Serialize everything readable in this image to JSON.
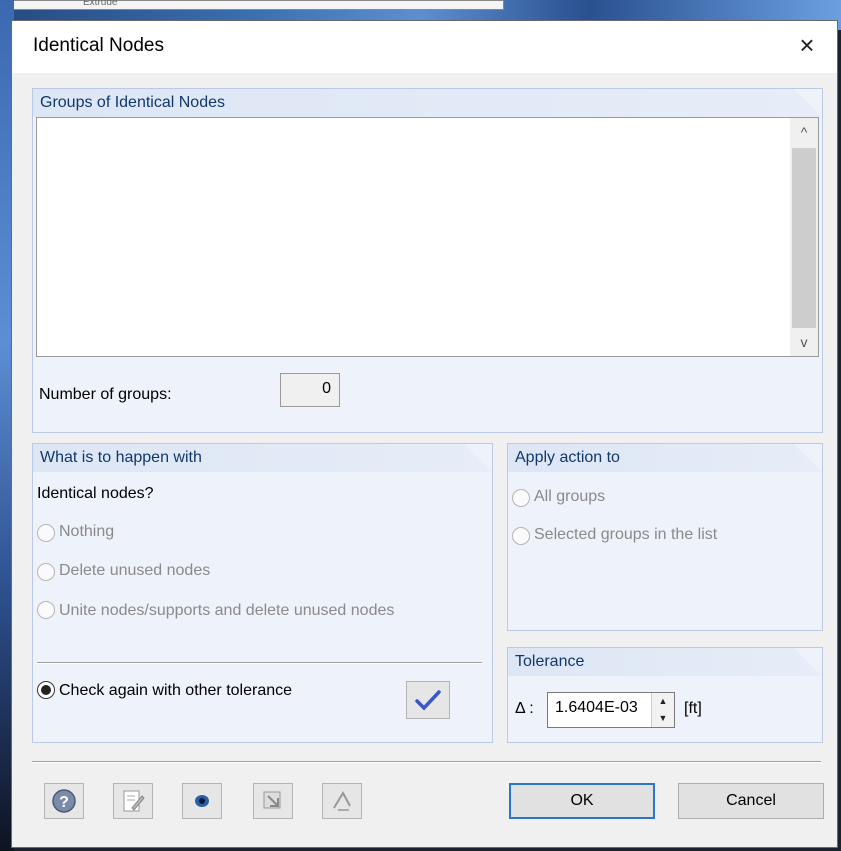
{
  "background": {
    "toolbar_fragment": "Extrude"
  },
  "dialog": {
    "title": "Identical Nodes",
    "close_glyph": "×"
  },
  "groups_section": {
    "title": "Groups of Identical Nodes",
    "number_label": "Number of groups:",
    "number_value": "0",
    "scroll_up": "^",
    "scroll_down": "v"
  },
  "action_section": {
    "title": "What is to happen with",
    "question": "Identical nodes?",
    "options": [
      {
        "label": "Nothing",
        "selected": false,
        "enabled": false
      },
      {
        "label": "Delete unused nodes",
        "selected": false,
        "enabled": false
      },
      {
        "label": "Unite nodes/supports and delete unused nodes",
        "selected": false,
        "enabled": false
      }
    ],
    "check_again_label": "Check again with other tolerance",
    "check_again_selected": true
  },
  "apply_section": {
    "title": "Apply action to",
    "options": [
      {
        "label": "All groups",
        "enabled": false
      },
      {
        "label": "Selected groups in the list",
        "enabled": false
      }
    ]
  },
  "tolerance_section": {
    "title": "Tolerance",
    "delta_label": "Δ :",
    "value": "1.6404E-03",
    "unit": "[ft]"
  },
  "footer": {
    "ok_label": "OK",
    "cancel_label": "Cancel",
    "icons": [
      "help-icon",
      "edit-icon",
      "view-icon",
      "export-icon",
      "node-icon"
    ]
  },
  "colors": {
    "accent": "#2c75c8",
    "group_title": "#10386a",
    "group_bg": "#eef2fa"
  }
}
